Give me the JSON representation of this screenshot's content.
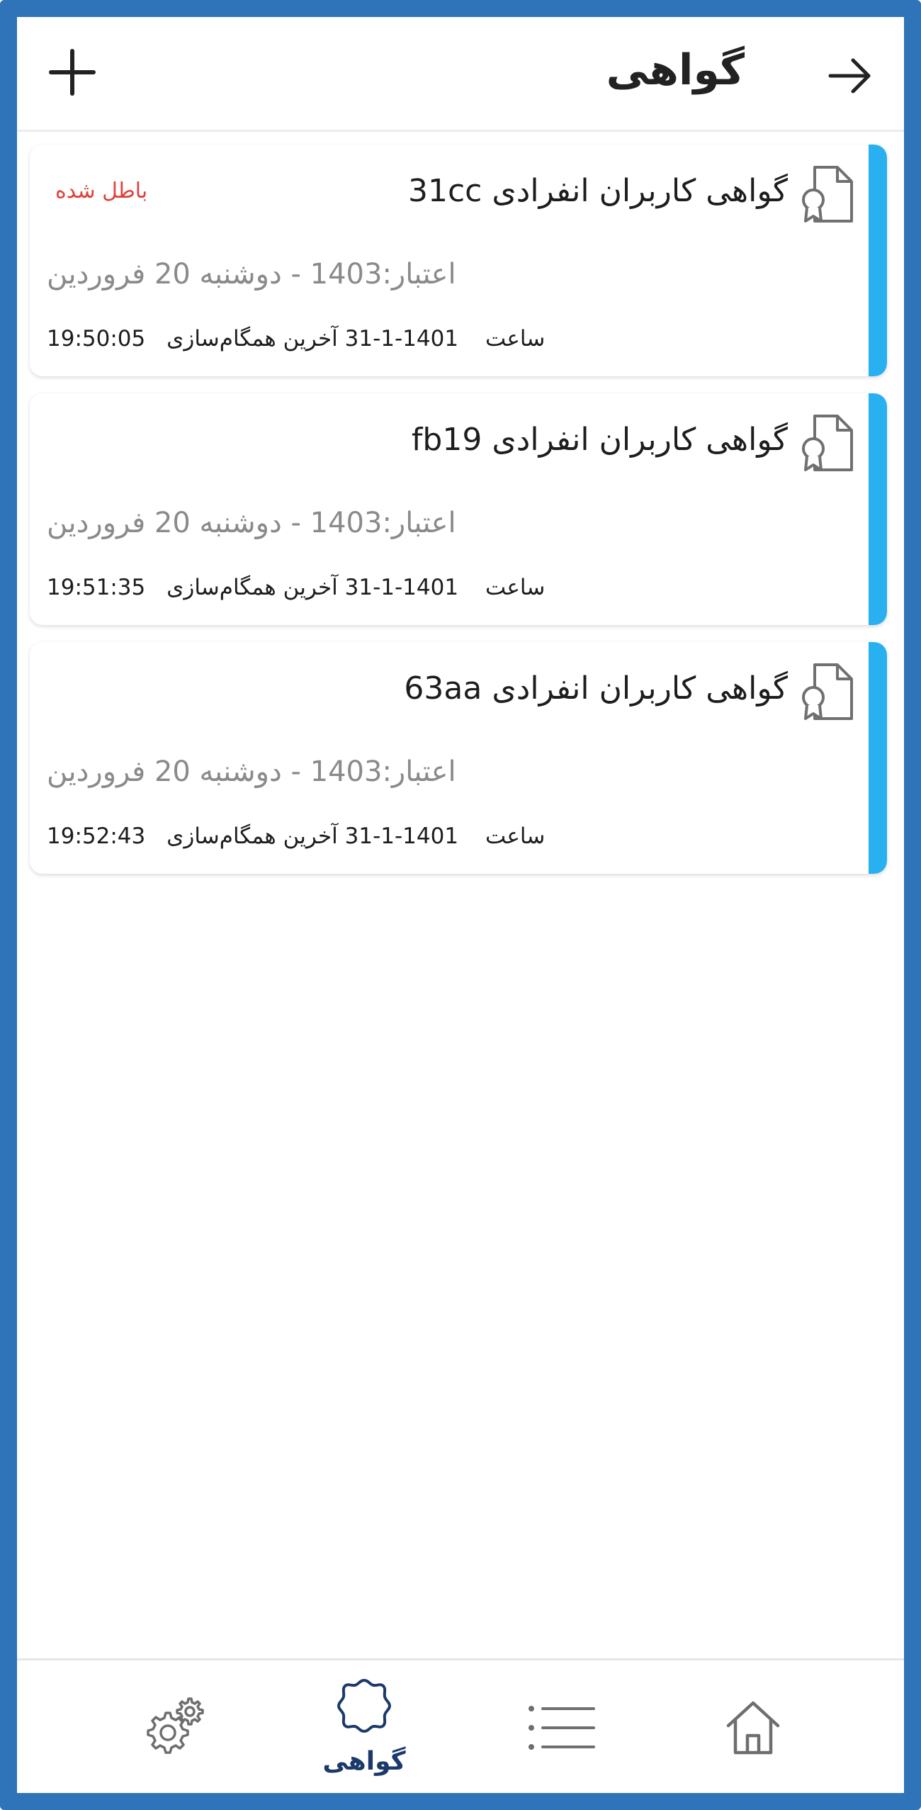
{
  "header": {
    "title": "گواهی",
    "back_icon": "arrow-right-icon",
    "add_icon": "plus-icon"
  },
  "certificates": [
    {
      "title": "گواهی کاربران انفرادی 31cc",
      "status": "باطل شده",
      "validity": "اعتبار:1403 - دوشنبه 20 فروردین",
      "sync_label": "آخرین همگام‌سازی",
      "sync_date": "1401-1-31",
      "sync_time_label": "ساعت",
      "sync_time": "19:50:05"
    },
    {
      "title": "گواهی کاربران انفرادی fb19",
      "status": "",
      "validity": "اعتبار:1403 - دوشنبه 20 فروردین",
      "sync_label": "آخرین همگام‌سازی",
      "sync_date": "1401-1-31",
      "sync_time_label": "ساعت",
      "sync_time": "19:51:35"
    },
    {
      "title": "گواهی کاربران انفرادی 63aa",
      "status": "",
      "validity": "اعتبار:1403 - دوشنبه 20 فروردین",
      "sync_label": "آخرین همگام‌سازی",
      "sync_date": "1401-1-31",
      "sync_time_label": "ساعت",
      "sync_time": "19:52:43"
    }
  ],
  "bottom_nav": {
    "settings_icon": "settings-gears-icon",
    "certificate_label": "گواهی",
    "certificate_icon": "certificate-badge-icon",
    "list_icon": "list-icon",
    "home_icon": "home-icon"
  },
  "colors": {
    "accent": "#29b0f0",
    "revoked": "#e0403a",
    "frame": "#2f74b8",
    "active_nav": "#1b3a6b"
  }
}
